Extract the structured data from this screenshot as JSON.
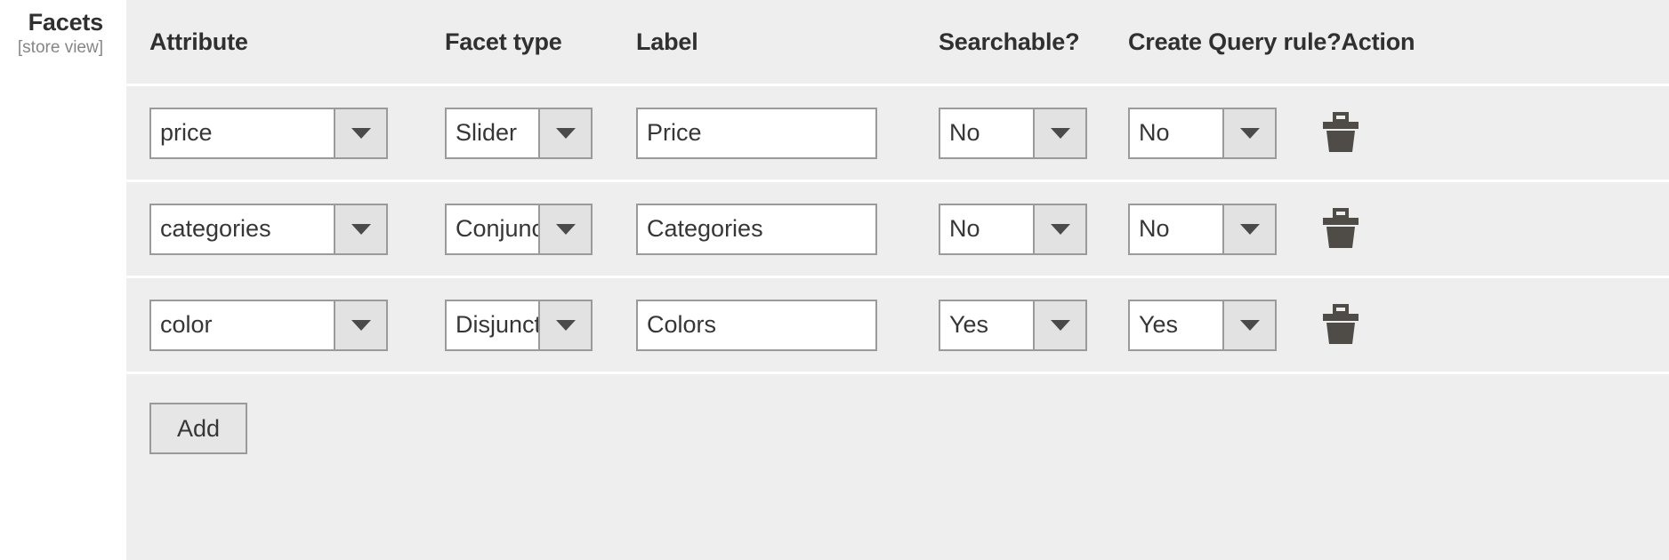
{
  "field": {
    "title": "Facets",
    "scope": "[store view]"
  },
  "table": {
    "headers": {
      "attribute": "Attribute",
      "facet_type": "Facet type",
      "label": "Label",
      "searchable": "Searchable?",
      "create_query_rule": "Create Query rule?",
      "action": "Action"
    },
    "rows": [
      {
        "attribute": "price",
        "facet_type": "Slider",
        "label": "Price",
        "searchable": "No",
        "create_query_rule": "No",
        "delete_icon": "trash-icon"
      },
      {
        "attribute": "categories",
        "facet_type": "Conjunc",
        "label": "Categories",
        "searchable": "No",
        "create_query_rule": "No",
        "delete_icon": "trash-icon"
      },
      {
        "attribute": "color",
        "facet_type": "Disjunct",
        "label": "Colors",
        "searchable": "Yes",
        "create_query_rule": "Yes",
        "delete_icon": "trash-icon"
      }
    ]
  },
  "footer": {
    "add_label": "Add"
  },
  "colors": {
    "panel_background": "#eeeeee",
    "page_background": "#ffffff",
    "text": "#303030",
    "muted_text": "#868686",
    "control_border": "#9a9a9a",
    "control_button": "#e2e2e2",
    "icon": "#4f4c47"
  }
}
